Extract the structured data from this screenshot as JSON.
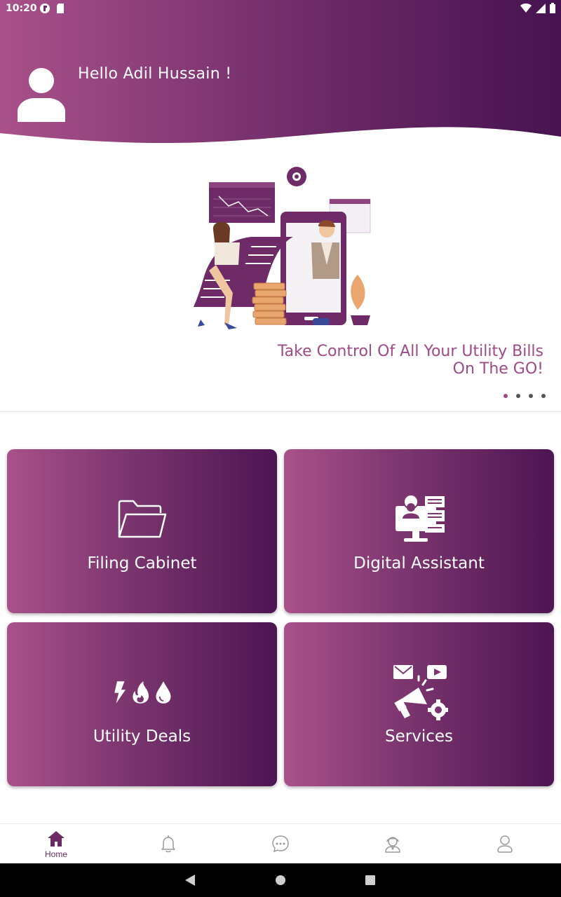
{
  "status_bar": {
    "time": "10:20"
  },
  "header": {
    "greeting": "Hello Adil Hussain !"
  },
  "carousel": {
    "headline_line1": "Take Control Of All Your Utility Bills",
    "headline_line2": "On The GO!",
    "page_count": 4,
    "active_page": 1
  },
  "tiles": [
    {
      "label": "Filing Cabinet",
      "icon": "folder-icon"
    },
    {
      "label": "Digital Assistant",
      "icon": "assistant-icon"
    },
    {
      "label": "Utility Deals",
      "icon": "utility-icon"
    },
    {
      "label": "Services",
      "icon": "services-icon"
    }
  ],
  "bottom_nav": {
    "items": [
      {
        "label": "Home",
        "icon": "home-icon",
        "active": true
      },
      {
        "label": "",
        "icon": "bell-icon",
        "active": false
      },
      {
        "label": "",
        "icon": "chat-icon",
        "active": false
      },
      {
        "label": "",
        "icon": "support-agent-icon",
        "active": false
      },
      {
        "label": "",
        "icon": "profile-icon",
        "active": false
      }
    ]
  },
  "colors": {
    "gradient_start": "#a9518a",
    "gradient_end": "#4d1552",
    "accent_text": "#a04a88",
    "nav_active": "#6b2a64"
  }
}
